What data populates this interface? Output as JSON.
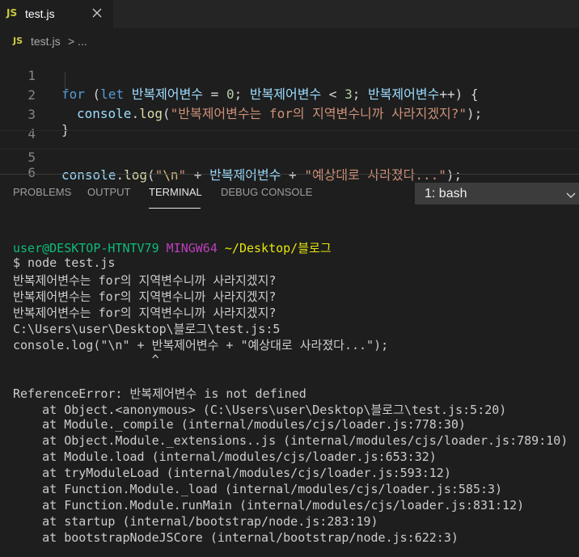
{
  "tab": {
    "icon_text": "JS",
    "filename": "test.js",
    "close_icon": "close-icon"
  },
  "breadcrumb": {
    "icon_text": "JS",
    "file": "test.js",
    "separator": ">",
    "more": "..."
  },
  "editor": {
    "line_numbers": [
      "1",
      "2",
      "3",
      "4",
      "5",
      "6"
    ],
    "line1": {
      "kw_for": "for",
      "p1": " (",
      "kw_let": "let",
      "var1": " 반복제어변수",
      "op1": " = ",
      "n0": "0",
      "semi1": "; ",
      "var2": "반복제어변수",
      "op2": " < ",
      "n3": "3",
      "semi2": "; ",
      "var3": "반복제어변수",
      "op3": "++) {"
    },
    "line2": {
      "obj": "console",
      "dot": ".",
      "fn": "log",
      "p": "(",
      "str": "\"반복제어변수는 for의 지역변수니까 사라지겠지?\"",
      "end": ");"
    },
    "line3": {
      "brace": "}"
    },
    "line5": {
      "obj": "console",
      "dot": ".",
      "fn": "log",
      "p": "(",
      "q1": "\"",
      "esc": "\\n",
      "q2": "\"",
      "plus1": " + ",
      "var": "반복제어변수",
      "plus2": " + ",
      "str": "\"예상대로 사라졌다...\"",
      "end": ");"
    }
  },
  "panel": {
    "tabs": [
      "PROBLEMS",
      "OUTPUT",
      "TERMINAL",
      "DEBUG CONSOLE"
    ],
    "shell_select": "1: bash"
  },
  "terminal": {
    "prompt_user": "user@DESKTOP-HTNTV79",
    "prompt_env": "MINGW64",
    "prompt_path": "~/Desktop/블로그",
    "command": "$ node test.js",
    "lines": [
      "반복제어변수는 for의 지역변수니까 사라지겠지?",
      "반복제어변수는 for의 지역변수니까 사라지겠지?",
      "반복제어변수는 for의 지역변수니까 사라지겠지?",
      "C:\\Users\\user\\Desktop\\블로그\\test.js:5",
      "console.log(\"\\n\" + 반복제어변수 + \"예상대로 사라졌다...\");",
      "                   ^",
      "",
      "ReferenceError: 반복제어변수 is not defined",
      "    at Object.<anonymous> (C:\\Users\\user\\Desktop\\블로그\\test.js:5:20)",
      "    at Module._compile (internal/modules/cjs/loader.js:778:30)",
      "    at Object.Module._extensions..js (internal/modules/cjs/loader.js:789:10)",
      "    at Module.load (internal/modules/cjs/loader.js:653:32)",
      "    at tryModuleLoad (internal/modules/cjs/loader.js:593:12)",
      "    at Function.Module._load (internal/modules/cjs/loader.js:585:3)",
      "    at Function.Module.runMain (internal/modules/cjs/loader.js:831:12)",
      "    at startup (internal/bootstrap/node.js:283:19)",
      "    at bootstrapNodeJSCore (internal/bootstrap/node.js:622:3)"
    ]
  },
  "colors": {
    "background": "#1e1e1e",
    "keyword": "#569cd6",
    "variable": "#9cdcfe",
    "string": "#ce9178",
    "number": "#b5cea8",
    "function": "#dcdcaa",
    "terminal_green": "#0dbc79",
    "terminal_magenta": "#bc3fbc",
    "terminal_yellow": "#e5e510",
    "js_icon": "#cbcb41"
  }
}
